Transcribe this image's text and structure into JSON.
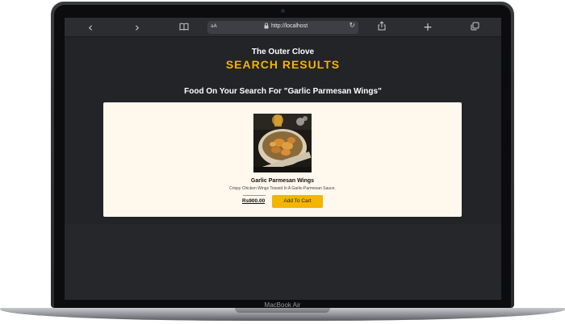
{
  "device": {
    "model_label": "MacBook Air"
  },
  "browser": {
    "back_icon": "‹",
    "forward_icon": "›",
    "reader_icon": "book-icon",
    "text_size_label": "aA",
    "url": "http://localhost",
    "reload_icon": "↻",
    "share_icon": "share-icon",
    "new_tab_icon": "+",
    "tabs_icon": "tabs-icon"
  },
  "page": {
    "brand": "The Outer Clove",
    "title": "SEARCH RESULTS",
    "subtitle": "Food On Your Search For \"Garlic Parmesan Wings\""
  },
  "result": {
    "name": "Garlic Parmesan Wings",
    "description": "Crispy Chicken Wings Tossed In A Garlic-Parmesan Sauce.",
    "price": "Rs900.00",
    "cart_button": "Add To Cart"
  },
  "colors": {
    "accent": "#f4b400",
    "page_background": "#222427",
    "card_background": "#fff8ec"
  }
}
